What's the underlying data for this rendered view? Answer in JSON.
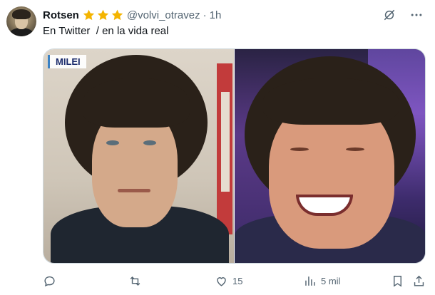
{
  "tweet": {
    "author_name": "Rotsen",
    "handle": "@volvi_otravez",
    "separator": "·",
    "time": "1h",
    "text": "En Twitter  / en la vida real",
    "stars": [
      "star",
      "star",
      "star"
    ],
    "star_color": "#f4b400"
  },
  "media": {
    "left_label": "MILEI",
    "left_photo_icon": "man-portrait-serious",
    "right_photo_icon": "man-portrait-laughing"
  },
  "actions": {
    "reply_icon": "reply-icon",
    "reply_count": "",
    "retweet_icon": "retweet-icon",
    "retweet_count": "",
    "like_icon": "heart-icon",
    "like_count": "15",
    "views_icon": "views-icon",
    "views_count": "5 mil",
    "bookmark_icon": "bookmark-icon",
    "share_icon": "share-icon"
  },
  "top_icons": [
    "grok-icon",
    "more-icon"
  ],
  "colors": {
    "text": "#0f1419",
    "muted": "#536471",
    "border": "#cfd9de"
  }
}
